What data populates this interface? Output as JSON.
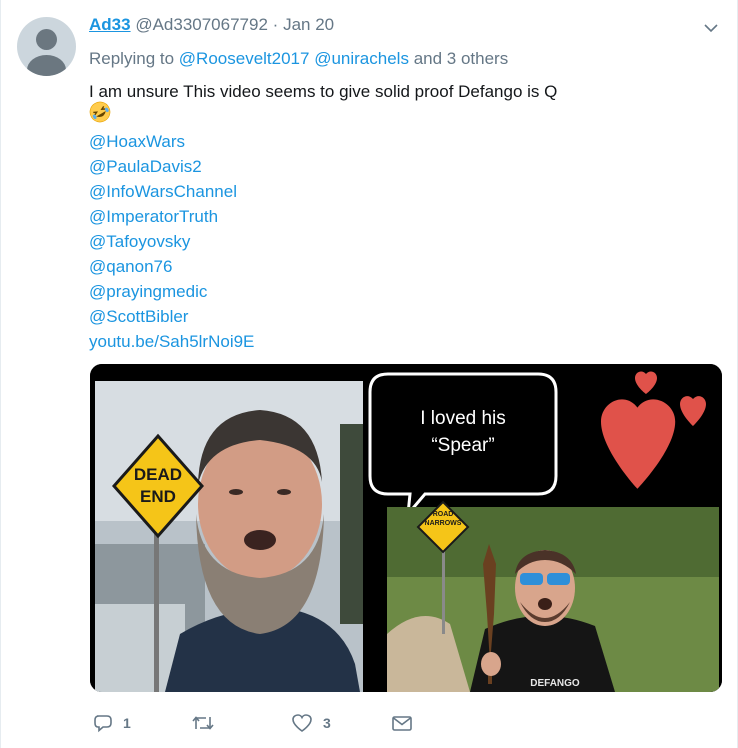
{
  "tweet": {
    "display_name": "Ad33",
    "handle": "@Ad3307067792",
    "separator": "·",
    "date": "Jan 20",
    "reply_prefix": "Replying to",
    "reply_to": [
      "@Roosevelt2017",
      "@unirachels"
    ],
    "reply_suffix": "and 3 others",
    "text": "I am unsure This video seems to give solid proof Defango is Q",
    "emoji": "rolling-on-floor-laughing-emoji",
    "mentions": [
      "@HoaxWars",
      "@PaulaDavis2",
      "@InfoWarsChannel",
      "@ImperatorTruth",
      "@Tafoyovsky",
      "@qanon76",
      "@prayingmedic",
      "@ScottBibler"
    ],
    "link": "youtu.be/Sah5lrNoi9E"
  },
  "media": {
    "speech_bubble_line1": "I loved his",
    "speech_bubble_line2": "“Spear”",
    "left_sign_line1": "DEAD",
    "left_sign_line2": "END",
    "right_sign_line1": "ROAD",
    "right_sign_line2": "NARROWS",
    "shirt_text": "DEFANGO",
    "colors": {
      "heart": "#e0524a",
      "sign": "#f5c518",
      "background": "#000000"
    }
  },
  "actions": {
    "reply_count": "1",
    "retweet_count": "",
    "like_count": "3"
  },
  "colors": {
    "link": "#1b95e0",
    "muted": "#657786",
    "text": "#14171a"
  }
}
